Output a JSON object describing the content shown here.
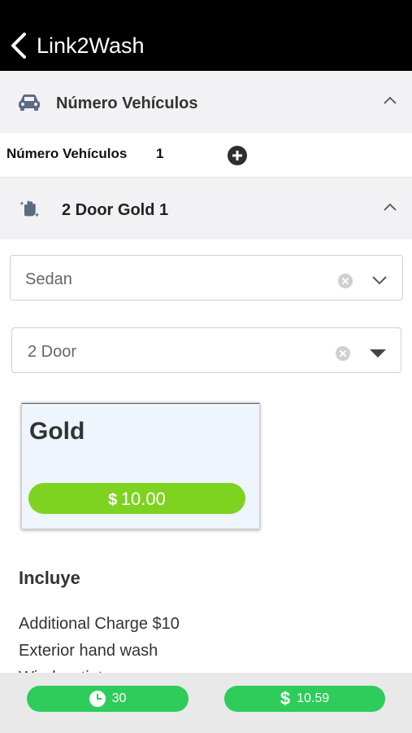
{
  "header": {
    "title": "Link2Wash",
    "back_icon": "chevron-left-icon"
  },
  "vehicles_section": {
    "title": "Número Vehículos",
    "icon": "car-icon",
    "row_label": "Número Vehículos",
    "count": "1",
    "add_icon": "plus-circle-icon"
  },
  "service_section": {
    "title": "2 Door Gold 1",
    "icon": "hand-sparkle-icon"
  },
  "vehicle_type_select": {
    "value": "Sedan"
  },
  "doors_select": {
    "value": "2 Door"
  },
  "plan": {
    "name": "Gold",
    "currency_symbol": "$",
    "price": "10.00"
  },
  "includes": {
    "title": "Incluye",
    "items": [
      "Additional Charge $10",
      "Exterior hand wash",
      "Window tint"
    ]
  },
  "footer": {
    "time_value": "30",
    "total_symbol": "$",
    "total_value": "10.59"
  },
  "colors": {
    "price_green": "#7ed321",
    "footer_green": "#2ecc5a",
    "nav_black": "#000000"
  }
}
